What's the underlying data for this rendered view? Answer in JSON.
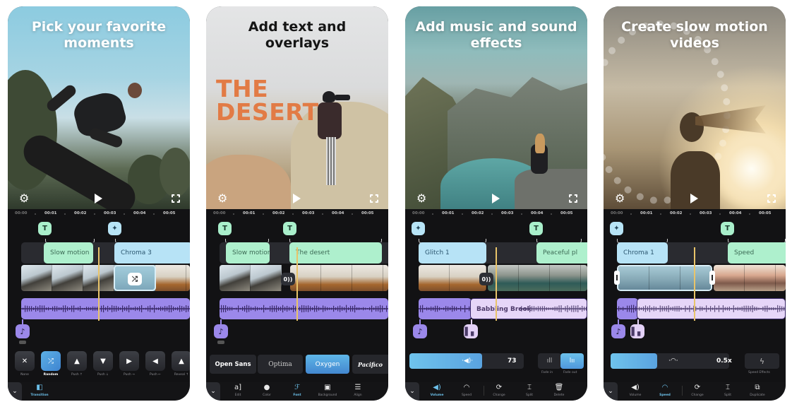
{
  "screens": [
    {
      "headline": "Pick your favorite moments",
      "timeline": {
        "ticks": [
          "00:00",
          "00:01",
          "00:02",
          "00:03",
          "00:04",
          "00:05"
        ],
        "badges": [
          "text-icon",
          "effect-wand-icon"
        ],
        "clips": [
          "Slow motion",
          "Chroma 3"
        ],
        "transition_button": "shuffle-icon"
      },
      "transitions": {
        "items": [
          {
            "label": "None",
            "glyph": "✕",
            "selected": false
          },
          {
            "label": "Random",
            "glyph": "⤮",
            "selected": true
          },
          {
            "label": "Push ↑",
            "glyph": "▲",
            "selected": false
          },
          {
            "label": "Push ↓",
            "glyph": "▼",
            "selected": false
          },
          {
            "label": "Push →",
            "glyph": "▶",
            "selected": false
          },
          {
            "label": "Push ←",
            "glyph": "◀",
            "selected": false
          },
          {
            "label": "Reveal ↑",
            "glyph": "▲",
            "selected": false
          }
        ]
      },
      "bottom_bar": [
        {
          "label": "Transition",
          "glyph": "◧",
          "selected": true
        }
      ]
    },
    {
      "headline": "Add text and overlays",
      "overlay_text": [
        "THE",
        "DESERT"
      ],
      "timeline": {
        "ticks": [
          "00:00",
          "00:01",
          "00:02",
          "00:03",
          "00:04",
          "00:05"
        ],
        "badges": [
          "text-icon",
          "text-icon"
        ],
        "clips": [
          "Slow motion",
          "The desert"
        ],
        "transition_button": "0))"
      },
      "fonts": {
        "items": [
          {
            "label": "Open Sans",
            "selected": false
          },
          {
            "label": "Optima",
            "selected": false
          },
          {
            "label": "Oxygen",
            "selected": true
          },
          {
            "label": "Pacifico",
            "selected": false
          }
        ]
      },
      "bottom_bar": [
        {
          "label": "Edit",
          "glyph": "a]",
          "selected": false
        },
        {
          "label": "Color",
          "glyph": "●",
          "selected": false
        },
        {
          "label": "Font",
          "glyph": "ℱ",
          "selected": true
        },
        {
          "label": "Background",
          "glyph": "▣",
          "selected": false
        },
        {
          "label": "Align",
          "glyph": "☰",
          "selected": false
        }
      ]
    },
    {
      "headline": "Add music and sound effects",
      "timeline": {
        "ticks": [
          "00:00",
          "00:01",
          "00:02",
          "00:03",
          "00:04",
          "00:05"
        ],
        "badges": [
          "effect-wand-icon",
          "text-icon"
        ],
        "clips": [
          "Glitch 1",
          "Peaceful pl"
        ],
        "transition_button": "0))",
        "audio_label": "Babbling Brook"
      },
      "volume": {
        "value": "73",
        "level_percent": 55,
        "fade_in_label": "Fade in",
        "fade_out_label": "Fade out",
        "fade_out_selected": true
      },
      "bottom_bar": [
        {
          "label": "Volume",
          "glyph": "◀)",
          "selected": true
        },
        {
          "label": "Speed",
          "glyph": "◠",
          "selected": false
        },
        {
          "label": "Change",
          "glyph": "⟳",
          "selected": false
        },
        {
          "label": "Split",
          "glyph": "⌶",
          "selected": false
        },
        {
          "label": "Delete",
          "glyph": "🗑",
          "selected": false
        }
      ]
    },
    {
      "headline": "Create slow motion videos",
      "timeline": {
        "ticks": [
          "00:00",
          "00:01",
          "00:02",
          "00:03",
          "00:04",
          "00:05"
        ],
        "badges": [
          "effect-wand-icon",
          "text-icon"
        ],
        "clips": [
          "Chroma 1",
          "Speed"
        ]
      },
      "speed": {
        "value": "0.5x",
        "level_percent": 27,
        "effects_label": "Speed Effects"
      },
      "bottom_bar": [
        {
          "label": "Volume",
          "glyph": "◀)",
          "selected": false
        },
        {
          "label": "Speed",
          "glyph": "◠",
          "selected": true
        },
        {
          "label": "Change",
          "glyph": "⟳",
          "selected": false
        },
        {
          "label": "Split",
          "glyph": "⌶",
          "selected": false
        },
        {
          "label": "Duplicate",
          "glyph": "⧉",
          "selected": false
        }
      ]
    }
  ],
  "colors": {
    "text_clip": "#aef0cd",
    "effect_clip": "#b7e3f6",
    "music_track": "#9b88ea",
    "sound_track": "#e6d6f8",
    "accent_blue": "#5aa3e0",
    "playhead": "#e9c46a"
  }
}
